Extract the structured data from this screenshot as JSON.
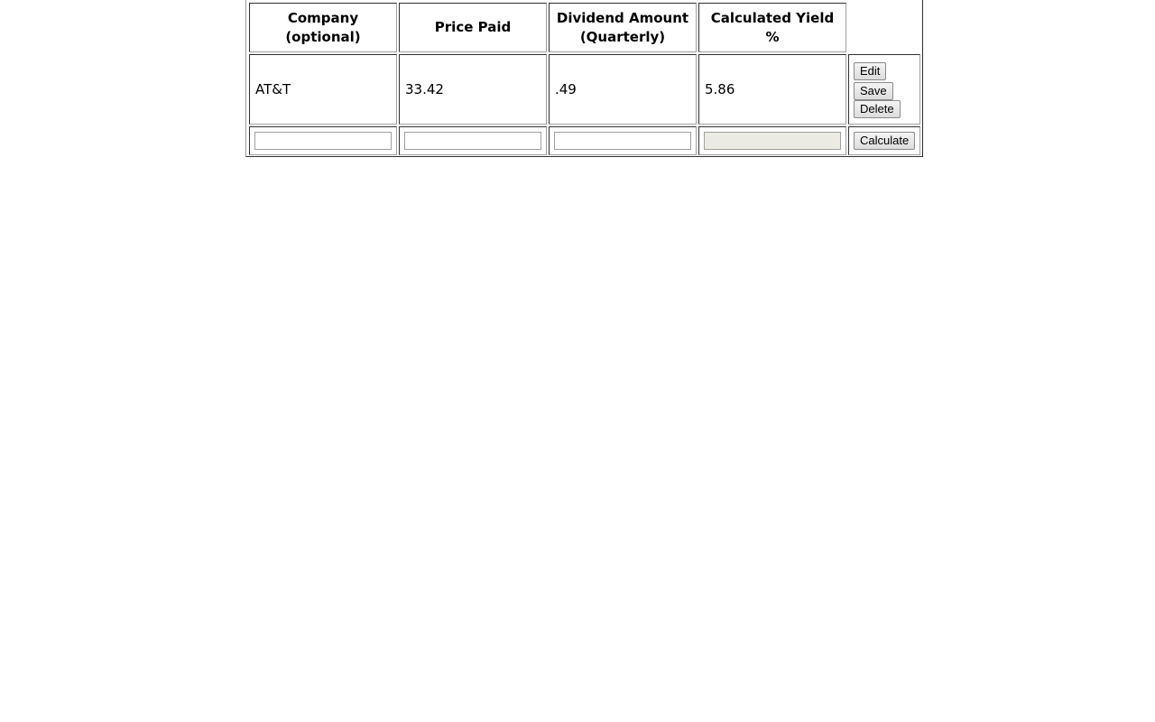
{
  "table": {
    "headers": [
      "Company (optional)",
      "Price Paid",
      "Dividend Amount (Quarterly)",
      "Calculated Yield %",
      ""
    ],
    "header_lines": {
      "dividend_line1": "Dividend Amount",
      "dividend_line2": "(Quarterly)"
    },
    "rows": [
      {
        "company": "AT&T",
        "price_paid": "33.42",
        "dividend": ".49",
        "yield": "5.86",
        "actions": {
          "edit": "Edit",
          "save": "Save",
          "delete": "Delete"
        }
      }
    ],
    "input_row": {
      "company_value": "",
      "price_value": "",
      "dividend_value": "",
      "yield_value": "",
      "calculate_label": "Calculate"
    }
  }
}
